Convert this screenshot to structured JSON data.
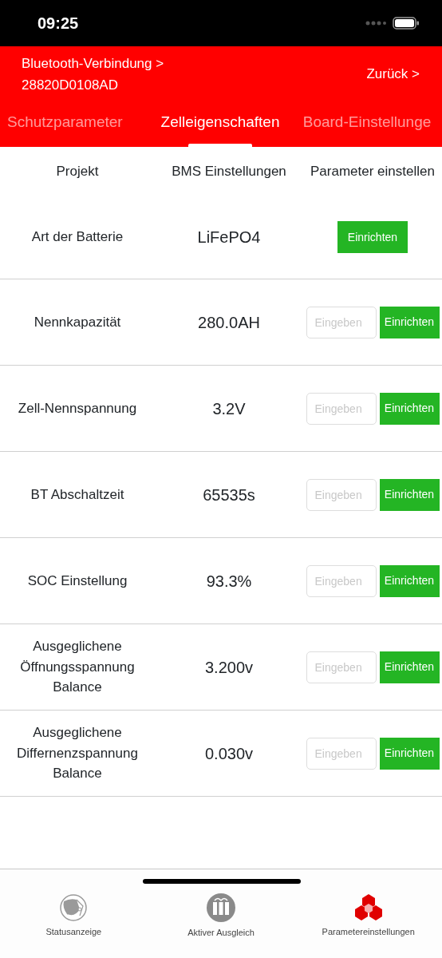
{
  "status_bar": {
    "time": "09:25"
  },
  "header": {
    "connection": "Bluetooth-Verbindung >",
    "device_id": "28820D0108AD",
    "back": "Zurück >"
  },
  "tabs": [
    {
      "label": "Schutzparameter",
      "selected": false
    },
    {
      "label": "Zelleigenschaften",
      "selected": true
    },
    {
      "label": "Board-Einstellunge",
      "selected": false
    }
  ],
  "table": {
    "columns": [
      "Projekt",
      "BMS Einstellungen",
      "Parameter einstellen"
    ],
    "rows": [
      {
        "kind": "select",
        "name": "Art der Batterie",
        "value": "LiFePO4",
        "button": "Einrichten"
      },
      {
        "kind": "input",
        "name": "Nennkapazität",
        "value": "280.0AH",
        "placeholder": "Eingeben",
        "button": "Einrichten"
      },
      {
        "kind": "input",
        "name": "Zell-Nennspannung",
        "value": "3.2V",
        "placeholder": "Eingeben",
        "button": "Einrichten"
      },
      {
        "kind": "input",
        "name": "BT Abschaltzeit",
        "value": "65535s",
        "placeholder": "Eingeben",
        "button": "Einrichten"
      },
      {
        "kind": "input",
        "name": "SOC Einstellung",
        "value": "93.3%",
        "placeholder": "Eingeben",
        "button": "Einrichten"
      },
      {
        "kind": "input",
        "name": "Ausgeglichene Öffnungsspannung Balance",
        "value": "3.200v",
        "placeholder": "Eingeben",
        "button": "Einrichten"
      },
      {
        "kind": "input",
        "name": "Ausgeglichene Differnenzspannung Balance",
        "value": "0.030v",
        "placeholder": "Eingeben",
        "button": "Einrichten"
      }
    ]
  },
  "tab_bar": [
    {
      "label": "Statusanzeige",
      "selected": false,
      "kind": "globe"
    },
    {
      "label": "Aktiver Ausgleich",
      "selected": false,
      "kind": "balance"
    },
    {
      "label": "Parametereinstellungen",
      "selected": true,
      "kind": "cubes"
    }
  ]
}
